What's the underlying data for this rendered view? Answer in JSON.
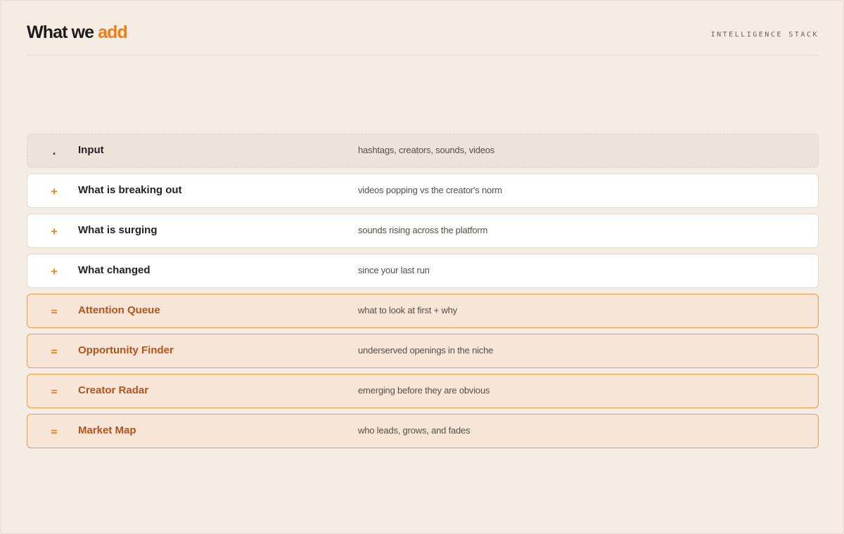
{
  "header": {
    "title_plain": "What we",
    "title_accent": "add",
    "stack_label": "INTELLIGENCE STACK"
  },
  "colors": {
    "background": "#f5ede3",
    "accent": "#f07e16",
    "result_text": "#b4531c",
    "result_fill": "#f7e5d7",
    "result_border": "#ef9a4c"
  },
  "rows": [
    {
      "kind": "input",
      "symbol": ".",
      "name": "Input",
      "description": "hashtags, creators, sounds, videos"
    },
    {
      "kind": "add",
      "symbol": "+",
      "name": "What is breaking out",
      "description": "videos popping vs the creator's norm"
    },
    {
      "kind": "add",
      "symbol": "+",
      "name": "What is surging",
      "description": "sounds rising across the platform"
    },
    {
      "kind": "add",
      "symbol": "+",
      "name": "What changed",
      "description": "since your last run"
    },
    {
      "kind": "result",
      "symbol": "=",
      "name": "Attention Queue",
      "description": "what to look at first + why"
    },
    {
      "kind": "result",
      "symbol": "=",
      "name": "Opportunity Finder",
      "description": "underserved openings in the niche"
    },
    {
      "kind": "result",
      "symbol": "=",
      "name": "Creator Radar",
      "description": "emerging before they are obvious"
    },
    {
      "kind": "result",
      "symbol": "=",
      "name": "Market Map",
      "description": "who leads, grows, and fades"
    }
  ]
}
